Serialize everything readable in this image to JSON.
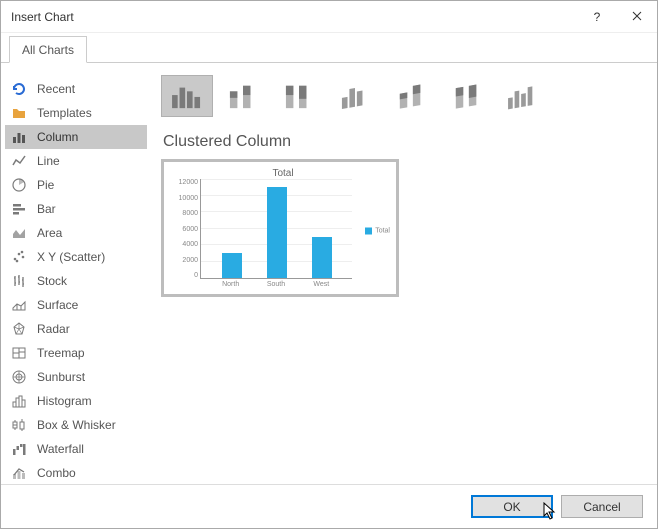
{
  "window": {
    "title": "Insert Chart"
  },
  "tabs": {
    "all_charts": "All Charts"
  },
  "sidebar": {
    "items": [
      {
        "label": "Recent"
      },
      {
        "label": "Templates"
      },
      {
        "label": "Column"
      },
      {
        "label": "Line"
      },
      {
        "label": "Pie"
      },
      {
        "label": "Bar"
      },
      {
        "label": "Area"
      },
      {
        "label": "X Y (Scatter)"
      },
      {
        "label": "Stock"
      },
      {
        "label": "Surface"
      },
      {
        "label": "Radar"
      },
      {
        "label": "Treemap"
      },
      {
        "label": "Sunburst"
      },
      {
        "label": "Histogram"
      },
      {
        "label": "Box & Whisker"
      },
      {
        "label": "Waterfall"
      },
      {
        "label": "Combo"
      }
    ],
    "selected_index": 2
  },
  "subtype_title": "Clustered Column",
  "chart_data": {
    "type": "bar",
    "title": "Total",
    "categories": [
      "North",
      "South",
      "West"
    ],
    "values": [
      3000,
      11000,
      5000
    ],
    "ylim": [
      0,
      12000
    ],
    "yticks": [
      0,
      2000,
      4000,
      6000,
      8000,
      10000,
      12000
    ],
    "legend": [
      "Total"
    ],
    "xlabel": "",
    "ylabel": ""
  },
  "buttons": {
    "ok": "OK",
    "cancel": "Cancel"
  }
}
